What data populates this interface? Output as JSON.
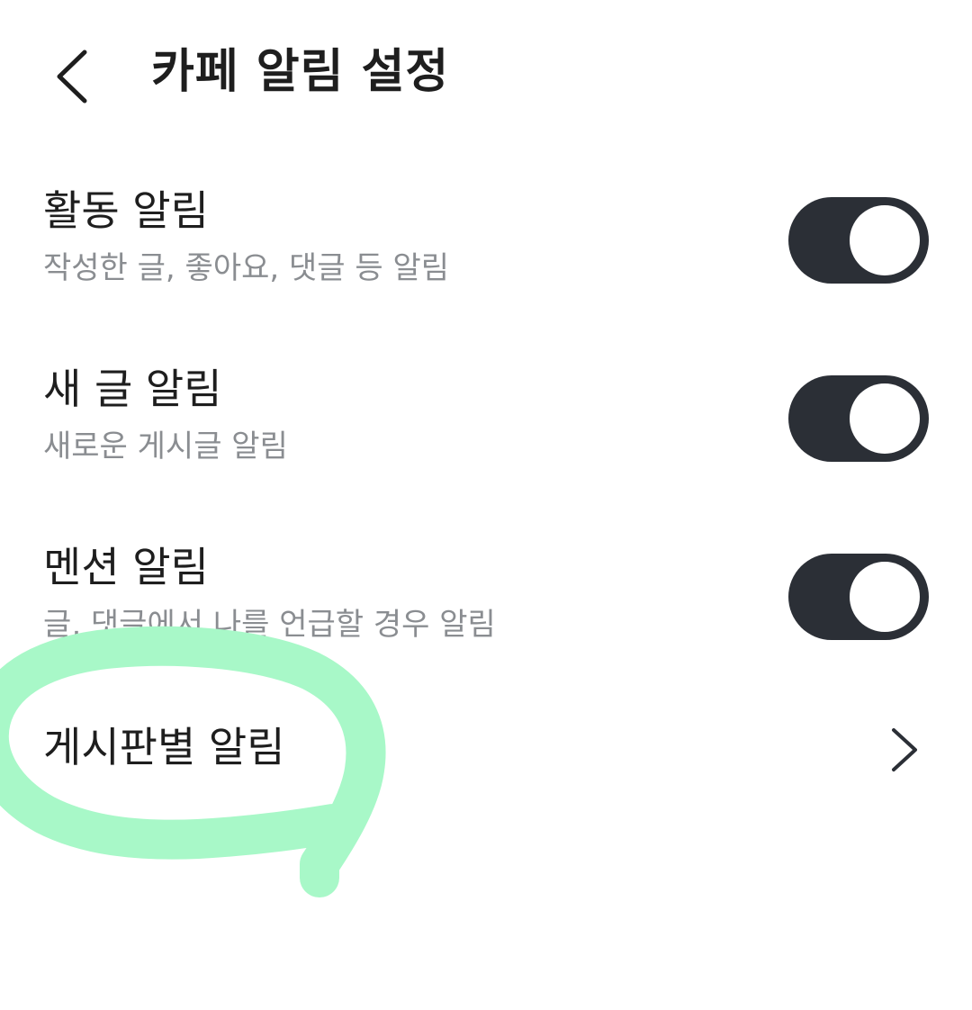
{
  "header": {
    "back_icon": "chevron-left-icon",
    "title": "카페 알림 설정"
  },
  "settings": [
    {
      "title": "활동 알림",
      "description": "작성한 글, 좋아요, 댓글 등 알림",
      "enabled": true
    },
    {
      "title": "새 글 알림",
      "description": "새로운 게시글 알림",
      "enabled": true
    },
    {
      "title": "멘션 알림",
      "description": "글, 댓글에서 나를 언급할 경우 알림",
      "enabled": true
    }
  ],
  "board_alerts": {
    "title": "게시판별 알림",
    "icon": "chevron-right-icon"
  },
  "colors": {
    "toggle_on": "#2b2f36",
    "description_text": "#8a8d91",
    "highlight_marker": "#a8f8c8"
  }
}
